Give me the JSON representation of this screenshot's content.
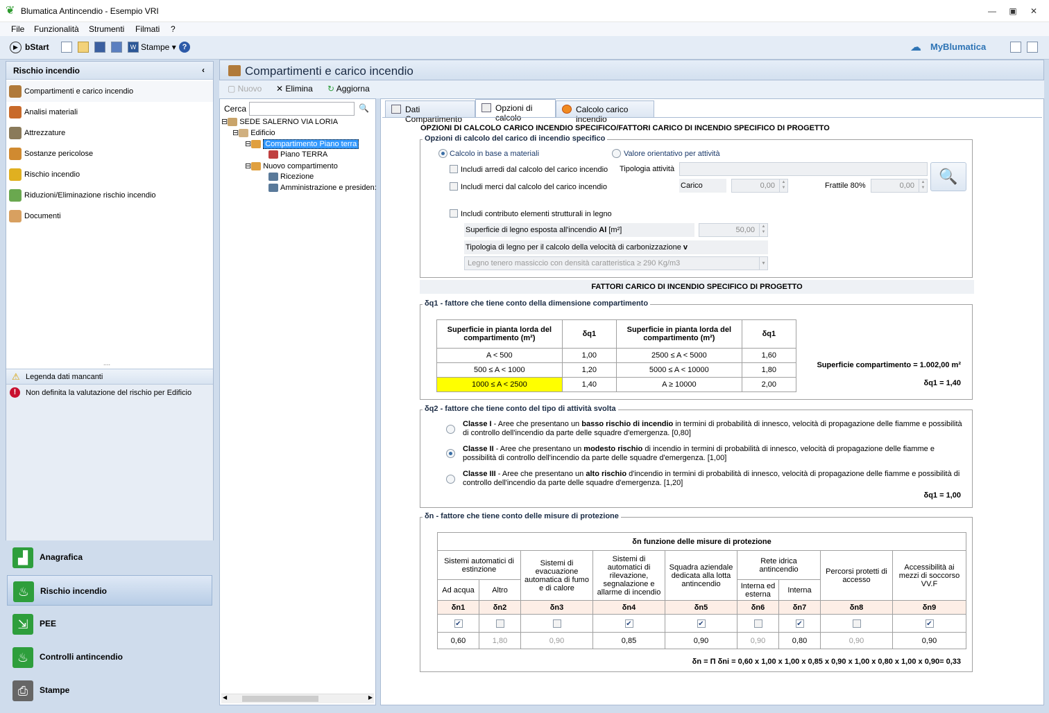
{
  "window": {
    "title": "Blumatica Antincendio - Esempio VRI"
  },
  "menu": [
    "File",
    "Funzionalità",
    "Strumenti",
    "Filmati",
    "?"
  ],
  "toolbar": {
    "bstart": "bStart",
    "stampe": "Stampe",
    "brand": "MyBlumatica"
  },
  "left": {
    "header": "Rischio incendio",
    "items": [
      {
        "label": "Compartimenti e carico incendio",
        "color": "#b07a3a"
      },
      {
        "label": "Analisi materiali",
        "color": "#c86a2a"
      },
      {
        "label": "Attrezzature",
        "color": "#8a7a5a"
      },
      {
        "label": "Sostanze pericolose",
        "color": "#d08a30"
      },
      {
        "label": "Rischio incendio",
        "color": "#e0b020"
      },
      {
        "label": "Riduzioni/Eliminazione rischio incendio",
        "color": "#6aa84f"
      },
      {
        "label": "Documenti",
        "color": "#d8a060"
      }
    ],
    "legend_title": "Legenda dati mancanti",
    "legend_msg": "Non definita la valutazione del rischio per Edificio",
    "bottom": [
      "Anagrafica",
      "Rischio incendio",
      "PEE",
      "Controlli antincendio",
      "Stampe"
    ]
  },
  "main": {
    "title": "Compartimenti e carico incendio",
    "actions": {
      "new": "Nuovo",
      "delete": "Elimina",
      "refresh": "Aggiorna"
    },
    "search_label": "Cerca",
    "tree": [
      "SEDE SALERNO VIA LORIA",
      "Edificio",
      "Compartimento Piano terra",
      "Piano TERRA",
      "Nuovo compartimento",
      "Ricezione",
      "Amministrazione e presiden:"
    ],
    "tabs": [
      "Dati Compartimento",
      "Opzioni di calcolo",
      "Calcolo carico incendio"
    ]
  },
  "opts": {
    "heading": "OPZIONI DI CALCOLO CARICO INCENDIO SPECIFICO/FATTORI CARICO DI INCENDIO SPECIFICO DI PROGETTO",
    "group": "Opzioni di calcolo del carico di incendio specifico",
    "radio1": "Calcolo in base a materiali",
    "radio2": "Valore orientativo per attività",
    "chk1": "Includi arredi dal calcolo del carico incendio",
    "chk2": "Includi merci dal calcolo del carico incendio",
    "tipologia": "Tipologia attività",
    "carico": "Carico",
    "carico_val": "0,00",
    "frattile": "Frattile 80%",
    "frattile_val": "0,00",
    "chk3": "Includi contributo elementi strutturali in legno",
    "sup_legno": "Superficie di legno esposta all'incendio",
    "sup_legno_sym": "Al",
    "sup_legno_unit": "[m²]",
    "sup_legno_val": "50,00",
    "tip_legno": "Tipologia di legno per il calcolo della velocità di carbonizzazione",
    "tip_legno_sym": "v",
    "tip_legno_val": "Legno tenero massiccio con densità caratteristica ≥ 290 Kg/m3"
  },
  "fattori": {
    "heading": "FATTORI CARICO DI INCENDIO SPECIFICO DI PROGETTO",
    "q1_title": "δq1  - fattore che tiene conto della  dimensione compartimento",
    "q1_head": [
      "Superficie in pianta lorda del compartimento (m²)",
      "δq1",
      "Superficie in pianta lorda del compartimento (m²)",
      "δq1"
    ],
    "q1_rows": [
      [
        "A < 500",
        "1,00",
        "2500 ≤ A < 5000",
        "1,60"
      ],
      [
        "500 ≤ A < 1000",
        "1,20",
        "5000 ≤ A < 10000",
        "1,80"
      ],
      [
        "1000 ≤ A < 2500",
        "1,40",
        "A ≥ 10000",
        "2,00"
      ]
    ],
    "sup_comp": "Superficie compartimento = 1.002,00 m²",
    "q1_res": "δq1 = 1,40",
    "q2_title": "δq2  - fattore che tiene conto del tipo di attività svolta",
    "classes": [
      {
        "name": "Classe I",
        "pre": " - Aree che presentano un ",
        "em": "basso rischio di incendio",
        "post": " in termini di probabilità di innesco, velocità di propagazione delle fiamme e possibilità di controllo dell'incendio da parte delle squadre d'emergenza. [0,80]"
      },
      {
        "name": "Classe II",
        "pre": " - Aree che presentano un ",
        "em": "modesto rischio",
        "post": " di incendio in termini di probabilità di innesco, velocità di propagazione delle fiamme e possibilità di controllo dell'incendio da parte delle squadre d'emergenza. [1,00]"
      },
      {
        "name": "Classe III",
        "pre": " - Aree che presentano un ",
        "em": "alto rischio",
        "post": " d'incendio in termini di probabilità di innesco, velocità di propagazione delle fiamme e possibilità di controllo dell'incendio da parte delle squadre d'emergenza. [1,20]"
      }
    ],
    "q2_res": "δq1 = 1,00",
    "n_title": "δn  - fattore che tiene conto delle misure di protezione",
    "n_table_title": "δn funzione delle misure di protezione",
    "n_groups": [
      "Sistemi automatici di estinzione",
      "Sistemi di evacuazione automatica di fumo e di calore",
      "Sistemi di automatici di rilevazione, segnalazione e allarme di incendio",
      "Squadra aziendale dedicata alla lotta antincendio",
      "Rete idrica antincendio",
      "Percorsi protetti di accesso",
      "Accessibilità ai mezzi di soccorso VV.F"
    ],
    "n_sub": [
      "Ad acqua",
      "Altro",
      "Interna ed esterna",
      "Interna"
    ],
    "n_syms": [
      "δn1",
      "δn2",
      "δn3",
      "δn4",
      "δn5",
      "δn6",
      "δn7",
      "δn8",
      "δn9"
    ],
    "n_checked": [
      true,
      false,
      false,
      true,
      true,
      false,
      true,
      false,
      true
    ],
    "n_vals": [
      "0,60",
      "1,80",
      "0,90",
      "0,85",
      "0,90",
      "0,90",
      "0,80",
      "0,90",
      "0,90"
    ],
    "n_formula": "δn = Π δni = 0,60 x 1,00 x 1,00 x 0,85 x 0,90 x 1,00  x 0,80 x 1,00 x 0,90= 0,33"
  }
}
